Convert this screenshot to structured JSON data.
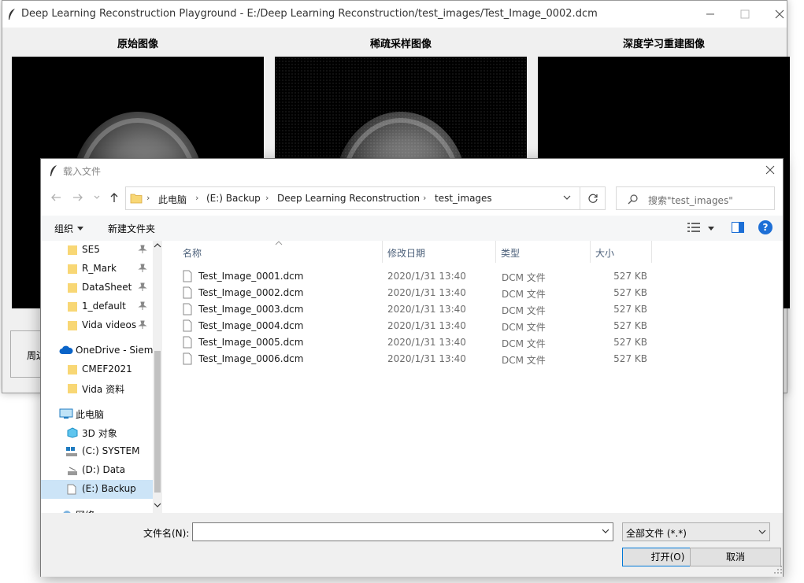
{
  "app": {
    "title": "Deep Learning Reconstruction Playground - E:/Deep Learning Reconstruction/test_images/Test_Image_0002.dcm",
    "panels": [
      "原始图像",
      "稀疏采样图像",
      "深度学习重建图像"
    ],
    "bottom_label": "周边"
  },
  "dialog": {
    "title": "载入文件",
    "breadcrumbs": [
      "此电脑",
      "(E:) Backup",
      "Deep Learning Reconstruction",
      "test_images"
    ],
    "search_placeholder": "搜索\"test_images\"",
    "toolbar": {
      "organize": "组织",
      "new_folder": "新建文件夹",
      "help": "?"
    },
    "sidebar": [
      {
        "label": "SE5",
        "icon": "folder-icon",
        "pinned": true
      },
      {
        "label": "R_Mark",
        "icon": "folder-icon",
        "pinned": true
      },
      {
        "label": "DataSheet",
        "icon": "folder-icon",
        "pinned": true
      },
      {
        "label": "1_default",
        "icon": "folder-icon",
        "pinned": true
      },
      {
        "label": "Vida videos",
        "icon": "folder-icon",
        "pinned": true
      },
      {
        "label": "OneDrive - Siem",
        "icon": "cloud-icon",
        "pinned": false
      },
      {
        "label": "CMEF2021",
        "icon": "folder-icon",
        "pinned": false
      },
      {
        "label": "Vida 资料",
        "icon": "folder-icon",
        "pinned": false
      },
      {
        "label": "此电脑",
        "icon": "computer-icon",
        "pinned": false
      },
      {
        "label": "3D 对象",
        "icon": "cube-icon",
        "pinned": false
      },
      {
        "label": "(C:) SYSTEM",
        "icon": "system-drive-icon",
        "pinned": false
      },
      {
        "label": "(D:) Data",
        "icon": "drive-icon",
        "pinned": false
      },
      {
        "label": "(E:) Backup",
        "icon": "drive-icon",
        "pinned": false,
        "selected": true
      },
      {
        "label": "网络",
        "icon": "network-icon",
        "pinned": false
      }
    ],
    "columns": [
      "名称",
      "修改日期",
      "类型",
      "大小"
    ],
    "files": [
      {
        "name": "Test_Image_0001.dcm",
        "date": "2020/1/31 13:40",
        "type": "DCM 文件",
        "size": "527 KB"
      },
      {
        "name": "Test_Image_0002.dcm",
        "date": "2020/1/31 13:40",
        "type": "DCM 文件",
        "size": "527 KB"
      },
      {
        "name": "Test_Image_0003.dcm",
        "date": "2020/1/31 13:40",
        "type": "DCM 文件",
        "size": "527 KB"
      },
      {
        "name": "Test_Image_0004.dcm",
        "date": "2020/1/31 13:40",
        "type": "DCM 文件",
        "size": "527 KB"
      },
      {
        "name": "Test_Image_0005.dcm",
        "date": "2020/1/31 13:40",
        "type": "DCM 文件",
        "size": "527 KB"
      },
      {
        "name": "Test_Image_0006.dcm",
        "date": "2020/1/31 13:40",
        "type": "DCM 文件",
        "size": "527 KB"
      }
    ],
    "filename_label": "文件名(N):",
    "filename_value": "",
    "filetype": "全部文件 (*.*)",
    "open_button": "打开(O)",
    "cancel_button": "取消"
  },
  "colors": {
    "selection": "#cce4f7",
    "accent": "#0078d7",
    "folder": "#f8d775",
    "help": "#1d6fd6"
  }
}
